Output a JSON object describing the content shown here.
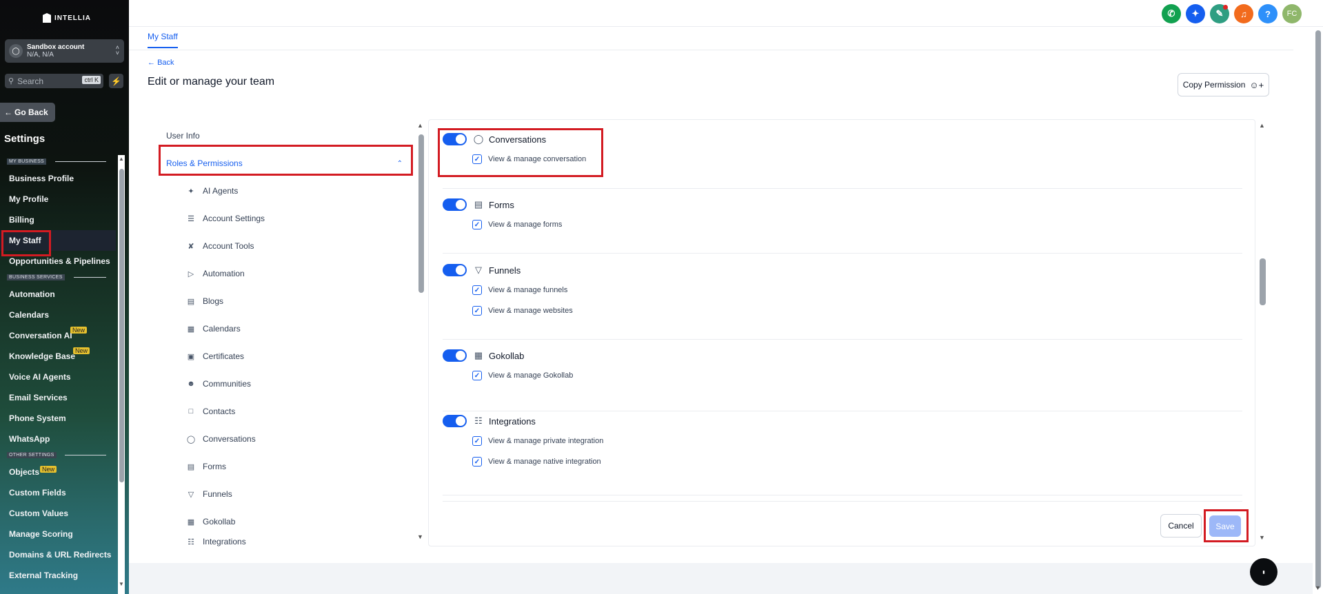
{
  "brand": {
    "name": "INTELLIA"
  },
  "account": {
    "name": "Sandbox account",
    "location": "N/A, N/A"
  },
  "search": {
    "placeholder": "Search",
    "shortcut": "ctrl K"
  },
  "sidebar": {
    "go_back": "Go Back",
    "title": "Settings",
    "sections": [
      {
        "label": "MY BUSINESS"
      },
      {
        "label": "BUSINESS SERVICES"
      },
      {
        "label": "OTHER SETTINGS"
      }
    ],
    "items": [
      {
        "label": "Business Profile"
      },
      {
        "label": "My Profile"
      },
      {
        "label": "Billing"
      },
      {
        "label": "My Staff"
      },
      {
        "label": "Opportunities & Pipelines"
      },
      {
        "label": "Automation"
      },
      {
        "label": "Calendars"
      },
      {
        "label": "Conversation AI",
        "badge": "New"
      },
      {
        "label": "Knowledge Base",
        "badge": "New"
      },
      {
        "label": "Voice AI Agents"
      },
      {
        "label": "Email Services"
      },
      {
        "label": "Phone System"
      },
      {
        "label": "WhatsApp"
      },
      {
        "label": "Objects",
        "badge": "New"
      },
      {
        "label": "Custom Fields"
      },
      {
        "label": "Custom Values"
      },
      {
        "label": "Manage Scoring"
      },
      {
        "label": "Domains & URL Redirects"
      },
      {
        "label": "External Tracking"
      }
    ]
  },
  "topbar": {
    "avatar_initials": "FC",
    "colors": {
      "phone": "#12a150",
      "ai": "#155eef",
      "megaphone": "#2f9e82",
      "bell": "#f26b1d",
      "help": "#2e90fa",
      "avatar": "#8fb76b"
    }
  },
  "tab": {
    "label": "My Staff"
  },
  "page": {
    "back": "Back",
    "title": "Edit or manage your team",
    "copy_permission": "Copy Permission"
  },
  "nav": {
    "user_info": "User Info",
    "roles": "Roles & Permissions",
    "items": [
      {
        "label": "AI Agents",
        "icon": "sparkle-icon"
      },
      {
        "label": "Account Settings",
        "icon": "sliders-icon"
      },
      {
        "label": "Account Tools",
        "icon": "tools-icon"
      },
      {
        "label": "Automation",
        "icon": "play-circle-icon"
      },
      {
        "label": "Blogs",
        "icon": "document-icon"
      },
      {
        "label": "Calendars",
        "icon": "calendar-icon"
      },
      {
        "label": "Certificates",
        "icon": "certificate-icon"
      },
      {
        "label": "Communities",
        "icon": "users-icon"
      },
      {
        "label": "Contacts",
        "icon": "contact-book-icon"
      },
      {
        "label": "Conversations",
        "icon": "chat-bubble-icon"
      },
      {
        "label": "Forms",
        "icon": "form-icon"
      },
      {
        "label": "Funnels",
        "icon": "funnel-icon"
      },
      {
        "label": "Gokollab",
        "icon": "building-icon"
      },
      {
        "label": "Integrations",
        "icon": "integration-icon"
      }
    ]
  },
  "permissions": {
    "groups": [
      {
        "title": "Conversations",
        "icon": "chat-bubble-icon",
        "perms": [
          "View & manage conversation"
        ]
      },
      {
        "title": "Forms",
        "icon": "form-icon",
        "perms": [
          "View & manage forms"
        ]
      },
      {
        "title": "Funnels",
        "icon": "funnel-icon",
        "perms": [
          "View & manage funnels",
          "View & manage websites"
        ]
      },
      {
        "title": "Gokollab",
        "icon": "building-icon",
        "perms": [
          "View & manage Gokollab"
        ]
      },
      {
        "title": "Integrations",
        "icon": "integration-icon",
        "perms": [
          "View & manage private integration",
          "View & manage native integration"
        ]
      }
    ],
    "cancel": "Cancel",
    "save": "Save"
  }
}
